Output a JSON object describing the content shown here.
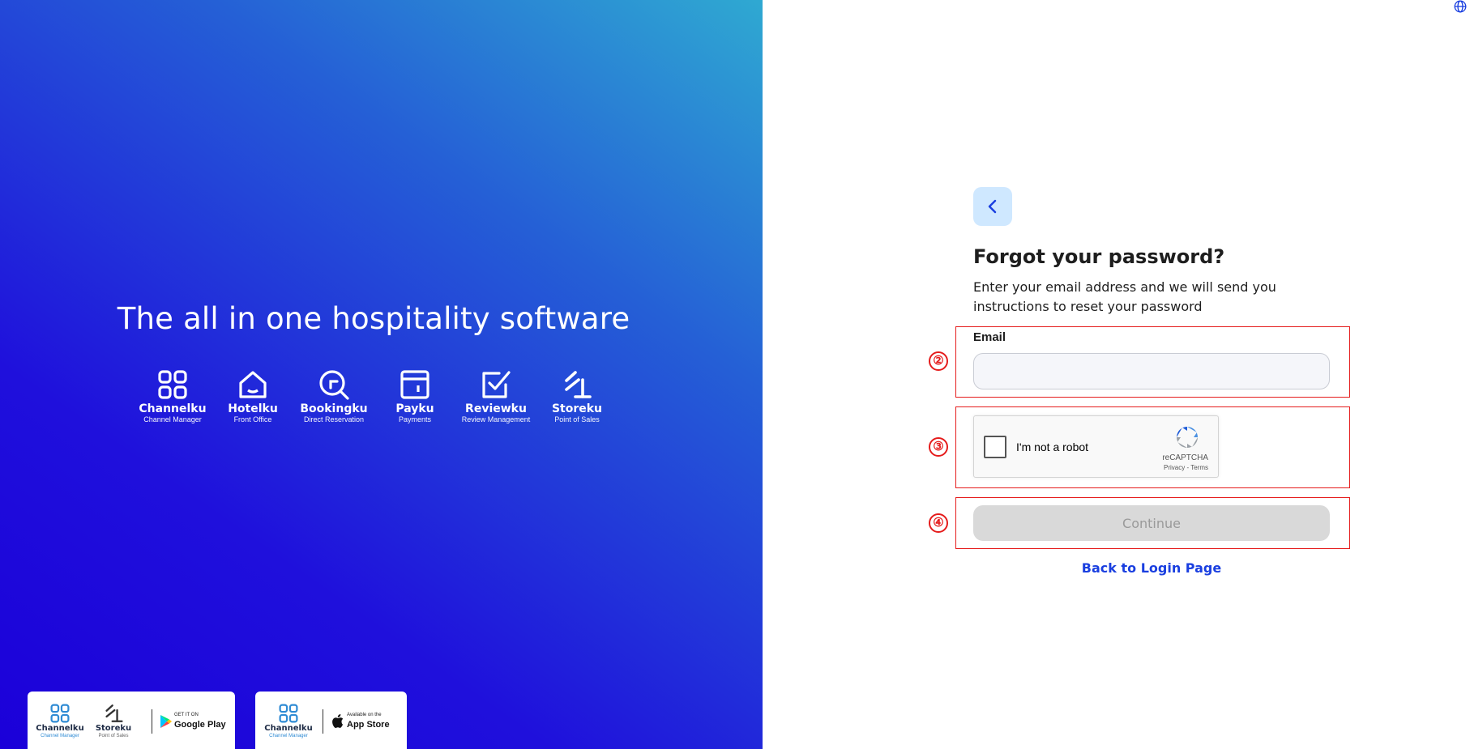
{
  "hero": {
    "title": "The all in one hospitality software",
    "products": [
      {
        "name": "Channelku",
        "desc": "Channel Manager",
        "icon": "grid-icon"
      },
      {
        "name": "Hotelku",
        "desc": "Front Office",
        "icon": "house-icon"
      },
      {
        "name": "Bookingku",
        "desc": "Direct Reservation",
        "icon": "magnifier-icon"
      },
      {
        "name": "Payku",
        "desc": "Payments",
        "icon": "wallet-icon"
      },
      {
        "name": "Reviewku",
        "desc": "Review Management",
        "icon": "checkbox-icon"
      },
      {
        "name": "Storeku",
        "desc": "Point of Sales",
        "icon": "storeku-icon"
      }
    ],
    "google_card": {
      "apps": [
        {
          "name": "Channelku",
          "desc": "Channel Manager"
        },
        {
          "name": "Storeku",
          "desc": "Point of Sales"
        }
      ],
      "badge_small": "GET IT ON",
      "badge_big": "Google Play"
    },
    "apple_card": {
      "apps": [
        {
          "name": "Channelku",
          "desc": "Channel Manager"
        }
      ],
      "badge_small": "Available on the",
      "badge_big": "App Store"
    }
  },
  "form": {
    "title": "Forgot your password?",
    "subtitle": "Enter your email address and we will send you instructions to reset your password",
    "email_label": "Email",
    "email_value": "",
    "email_placeholder": "",
    "recaptcha": {
      "label": "I'm not a robot",
      "brand": "reCAPTCHA",
      "links": "Privacy - Terms"
    },
    "continue_label": "Continue",
    "back_link": "Back to Login Page"
  },
  "annotations": [
    "②",
    "③",
    "④"
  ],
  "colors": {
    "accent": "#1a3fe0",
    "annotation": "#e51c1c",
    "back_button_bg": "#cfe8ff"
  }
}
